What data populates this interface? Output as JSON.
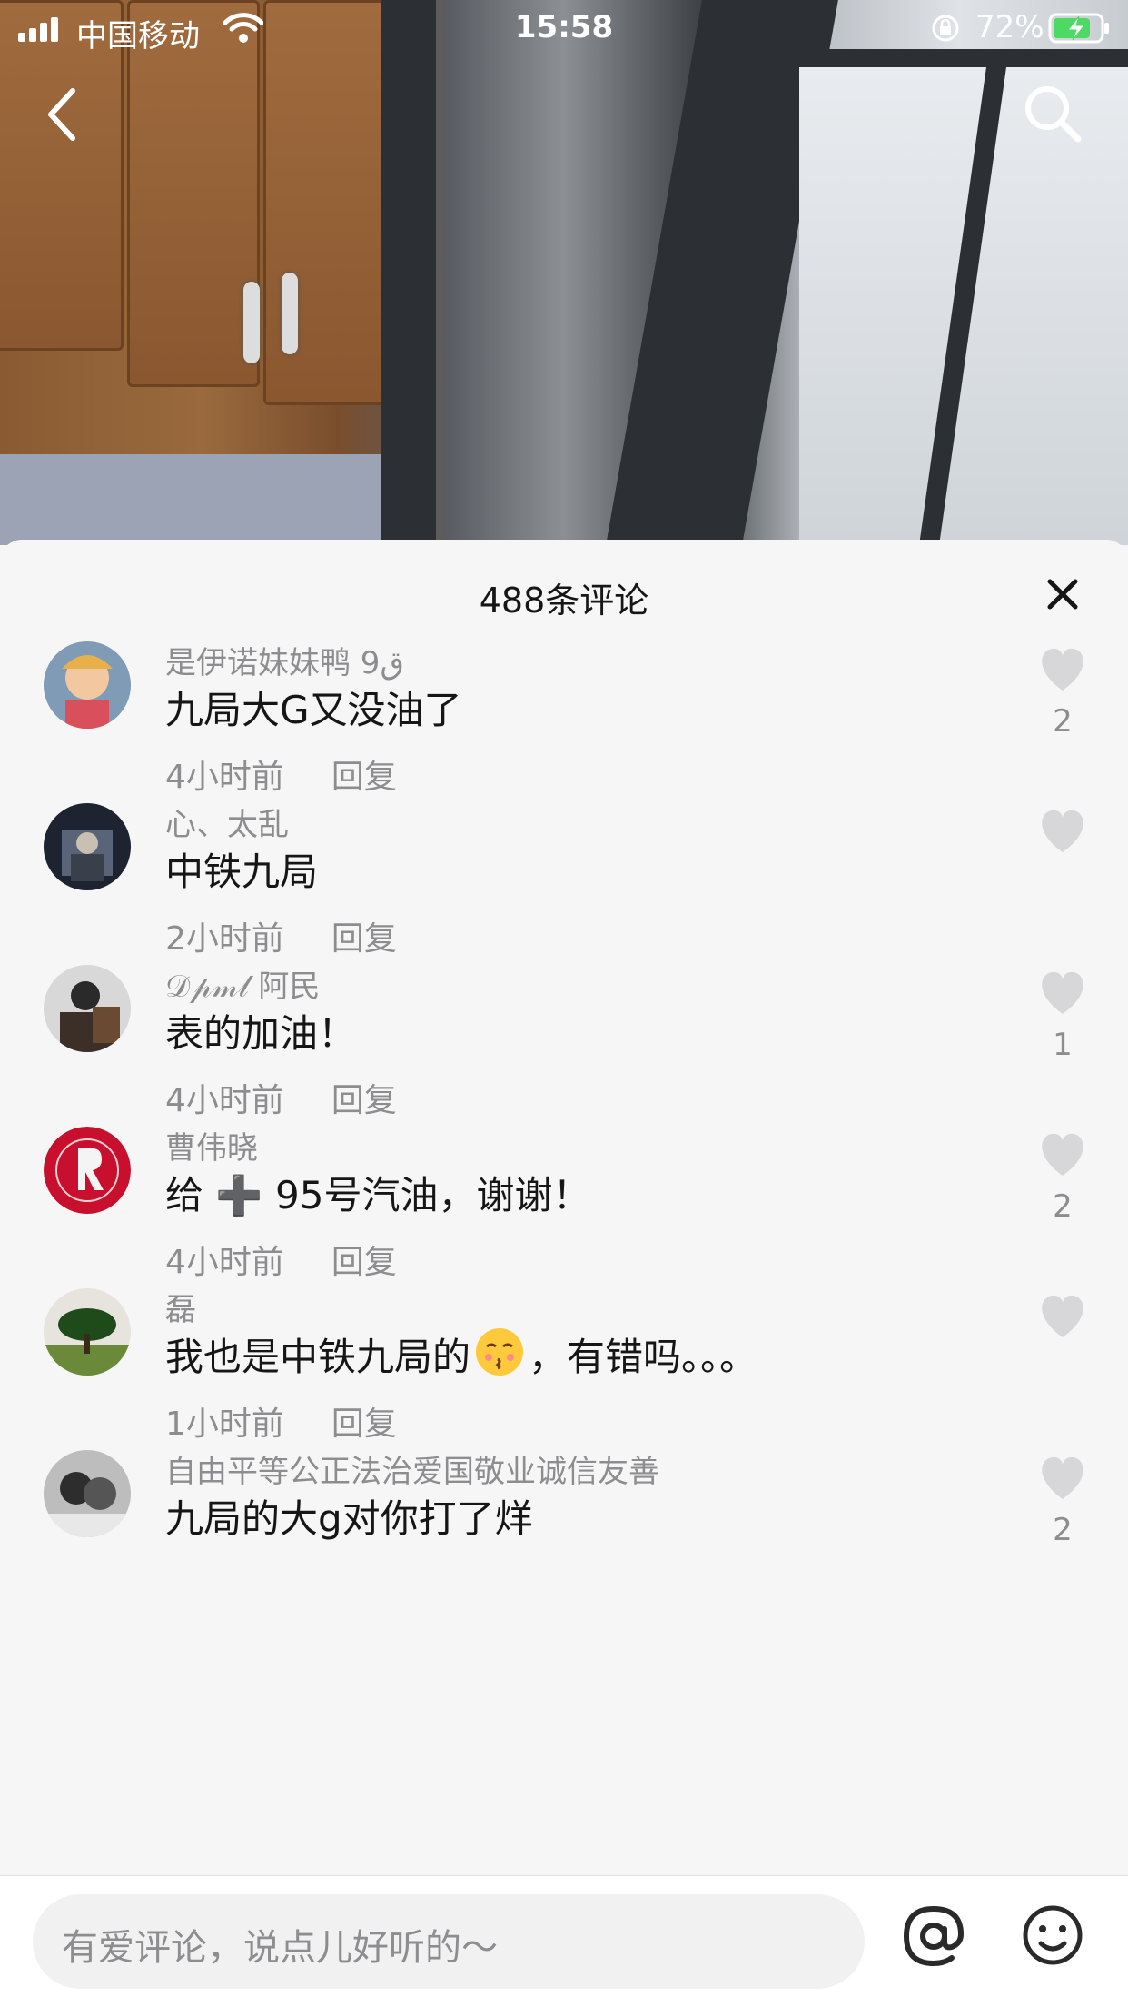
{
  "status_bar": {
    "carrier": "中国移动",
    "time": "15:58",
    "battery": "72%"
  },
  "sheet": {
    "title": "488条评论"
  },
  "comments": [
    {
      "username": "是伊诺妹妹鸭 9ق",
      "content": "九局大G又没油了",
      "time": "4小时前",
      "reply": "回复",
      "likes": "2"
    },
    {
      "username": "心、太乱",
      "content": "中铁九局",
      "time": "2小时前",
      "reply": "回复",
      "likes": ""
    },
    {
      "username": "𝒟𝓅𝓂𝓁 阿民",
      "content": "表的加油！",
      "time": "4小时前",
      "reply": "回复",
      "likes": "1"
    },
    {
      "username": "曹伟晓",
      "content": "给 ➕ 95号汽油，谢谢！",
      "time": "4小时前",
      "reply": "回复",
      "likes": "2"
    },
    {
      "username": "磊",
      "content_before": "我也是中铁九局的",
      "content_after": "，有错吗。。。",
      "time": "1小时前",
      "reply": "回复",
      "likes": ""
    },
    {
      "username": "自由平等公正法治爱国敬业诚信友善",
      "content": "九局的大g对你打了烊",
      "time": "",
      "reply": "",
      "likes": "2"
    }
  ],
  "input": {
    "placeholder": "有爱评论，说点儿好听的～"
  },
  "colors": {
    "accent_text": "#161616",
    "muted_text": "#8d8d8f",
    "sheet_bg": "#f6f6f6",
    "battery_green": "#4cd964"
  }
}
